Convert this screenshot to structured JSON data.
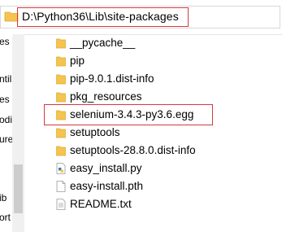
{
  "address": {
    "path": "D:\\Python36\\Lib\\site-packages"
  },
  "nav": {
    "items": [
      "es",
      "",
      "ntil",
      "es",
      "odi",
      "ure",
      "",
      "",
      "",
      "ib",
      "ort"
    ]
  },
  "files": [
    {
      "name": "__pycache__",
      "type": "folder"
    },
    {
      "name": "pip",
      "type": "folder"
    },
    {
      "name": "pip-9.0.1.dist-info",
      "type": "folder"
    },
    {
      "name": "pkg_resources",
      "type": "folder"
    },
    {
      "name": "selenium-3.4.3-py3.6.egg",
      "type": "folder",
      "highlighted": true
    },
    {
      "name": "setuptools",
      "type": "folder"
    },
    {
      "name": "setuptools-28.8.0.dist-info",
      "type": "folder"
    },
    {
      "name": "easy_install.py",
      "type": "python-file"
    },
    {
      "name": "easy-install.pth",
      "type": "file"
    },
    {
      "name": "README.txt",
      "type": "file"
    }
  ],
  "colors": {
    "highlight": "#d7393f",
    "folder": "#f4c44e",
    "folder_dark": "#e2a72f"
  }
}
